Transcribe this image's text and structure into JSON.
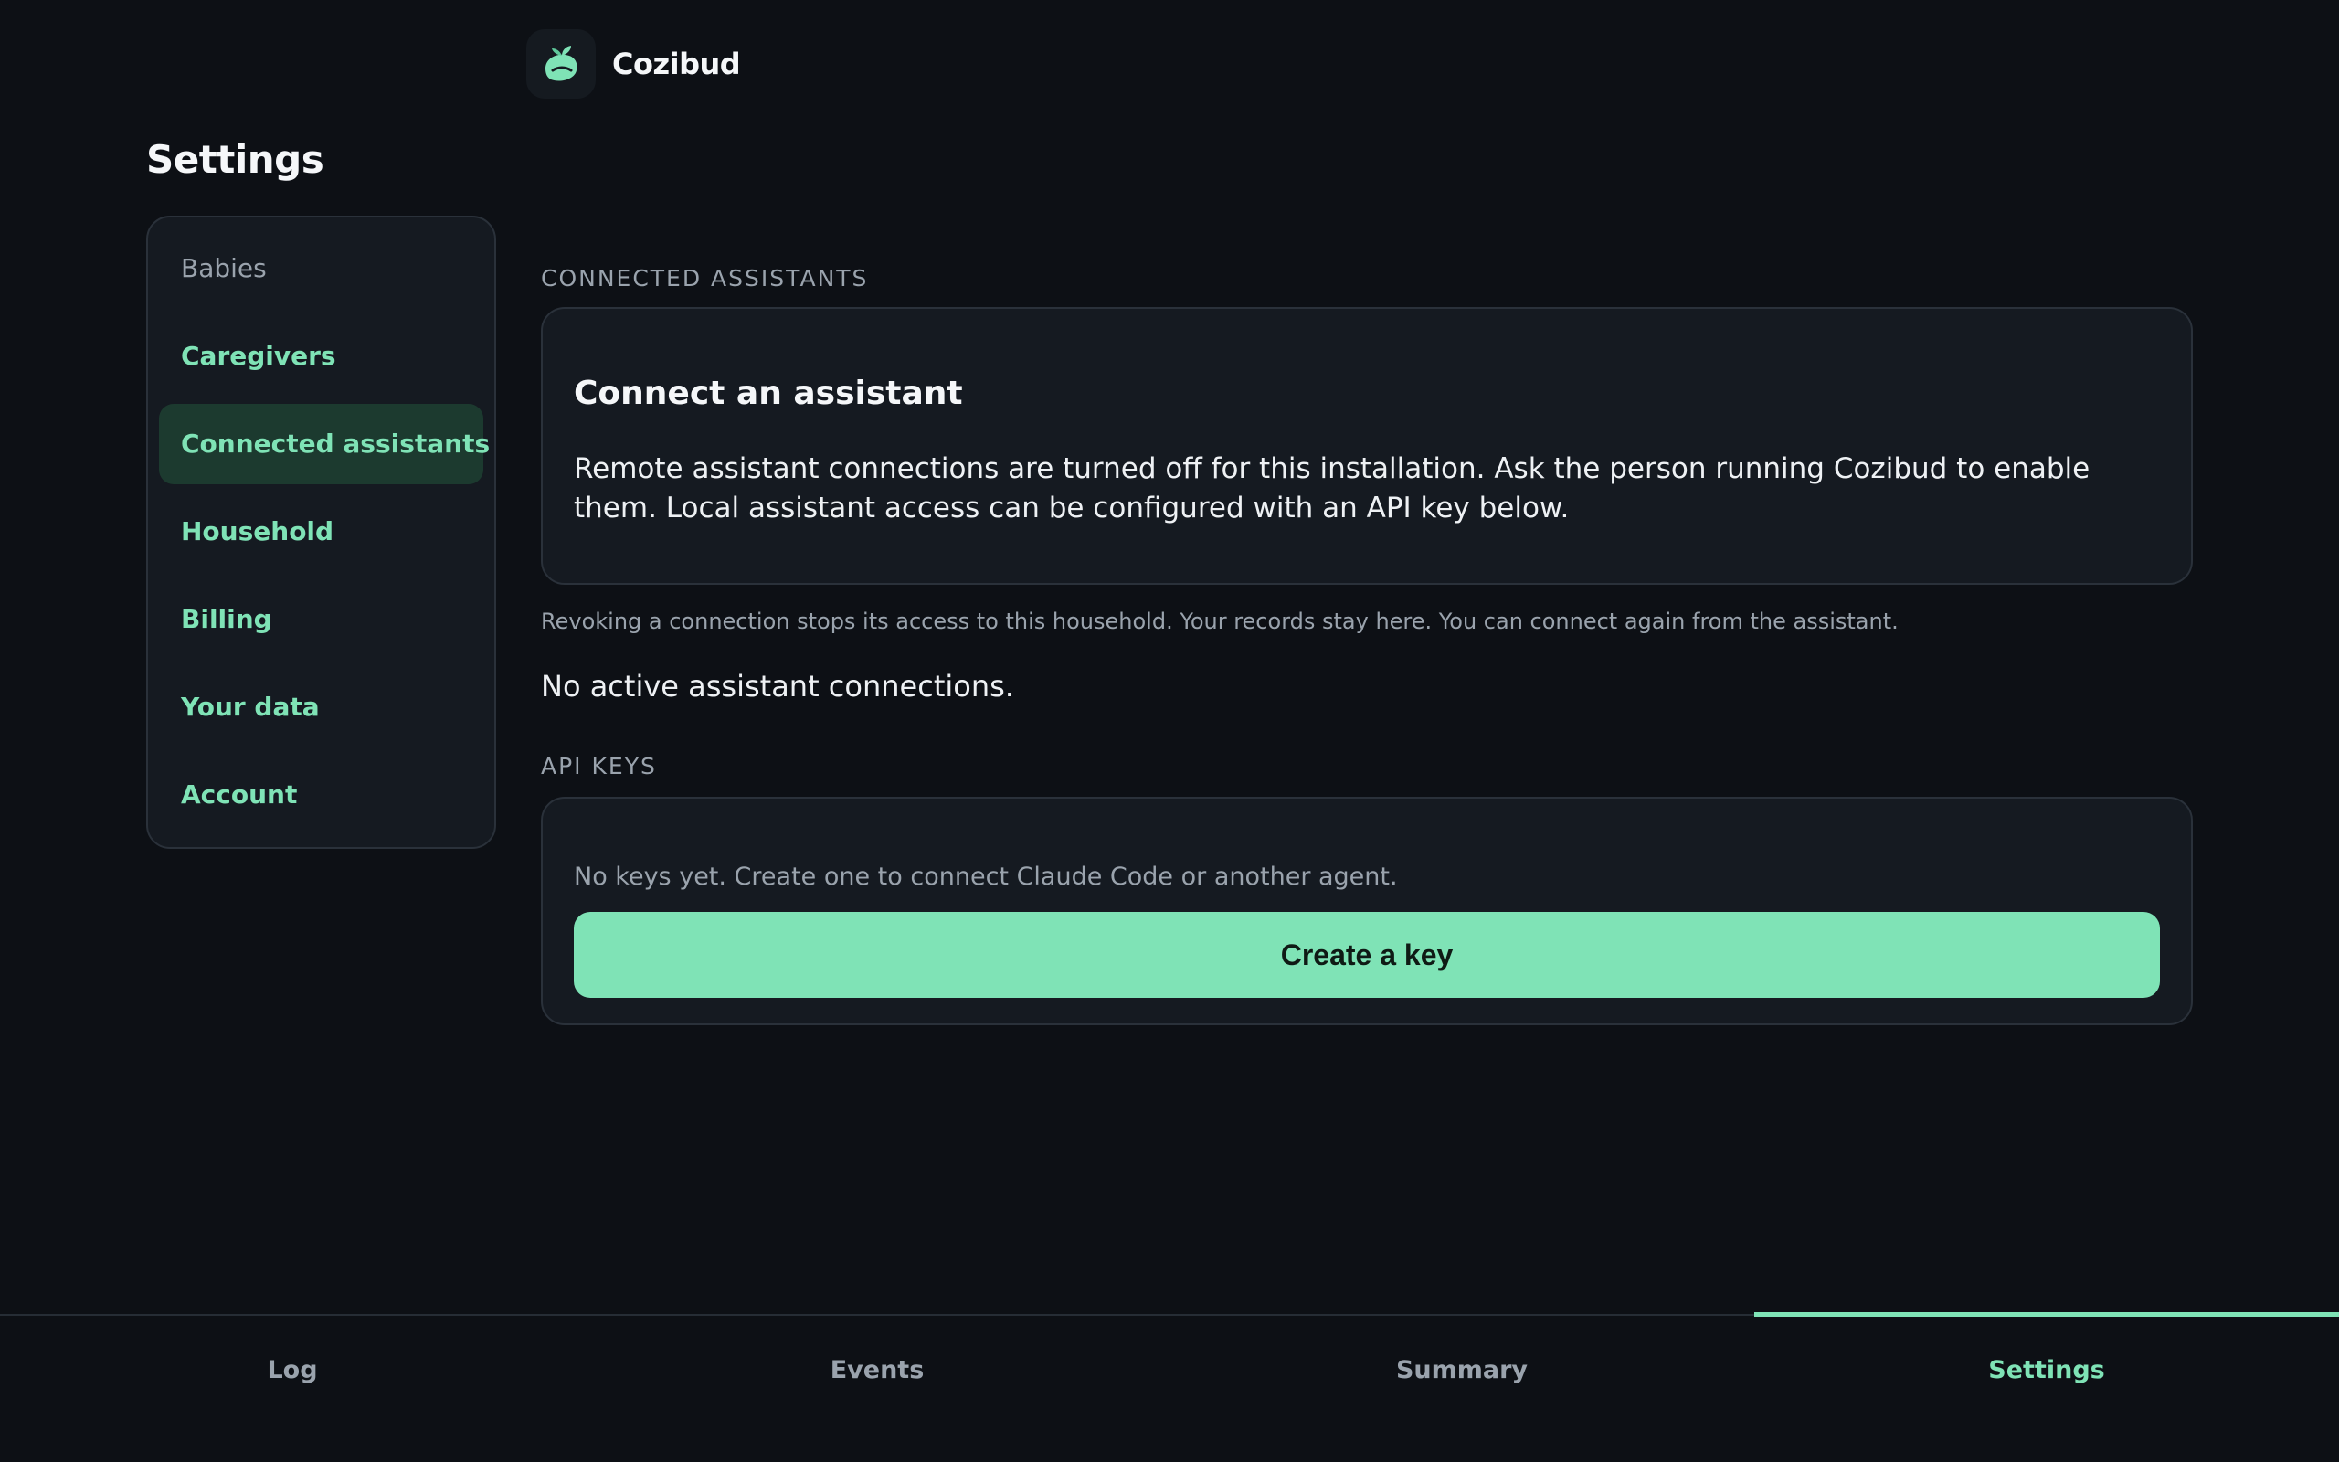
{
  "app": {
    "name": "Cozibud",
    "logo_icon": "leaf-sprout-icon",
    "accent_color": "#7fe3b6",
    "background_color": "#0d1015"
  },
  "page": {
    "title": "Settings"
  },
  "sidebar": {
    "items": [
      {
        "label": "Babies",
        "state": "muted"
      },
      {
        "label": "Caregivers",
        "state": "link"
      },
      {
        "label": "Connected assistants",
        "state": "active"
      },
      {
        "label": "Household",
        "state": "link"
      },
      {
        "label": "Billing",
        "state": "link"
      },
      {
        "label": "Your data",
        "state": "link"
      },
      {
        "label": "Account",
        "state": "link"
      }
    ]
  },
  "connected_assistants": {
    "section_label": "CONNECTED ASSISTANTS",
    "card_title": "Connect an assistant",
    "card_body": "Remote assistant connections are turned off for this installation. Ask the person running Cozibud to enable them. Local assistant access can be configured with an API key below.",
    "helper_text": "Revoking a connection stops its access to this household. Your records stay here. You can connect again from the assistant.",
    "empty_state": "No active assistant connections."
  },
  "api_keys": {
    "section_label": "API KEYS",
    "empty_text": "No keys yet. Create one to connect Claude Code or another agent.",
    "create_button_label": "Create a key"
  },
  "tabbar": {
    "tabs": [
      {
        "label": "Log",
        "active": false
      },
      {
        "label": "Events",
        "active": false
      },
      {
        "label": "Summary",
        "active": false
      },
      {
        "label": "Settings",
        "active": true
      }
    ]
  }
}
